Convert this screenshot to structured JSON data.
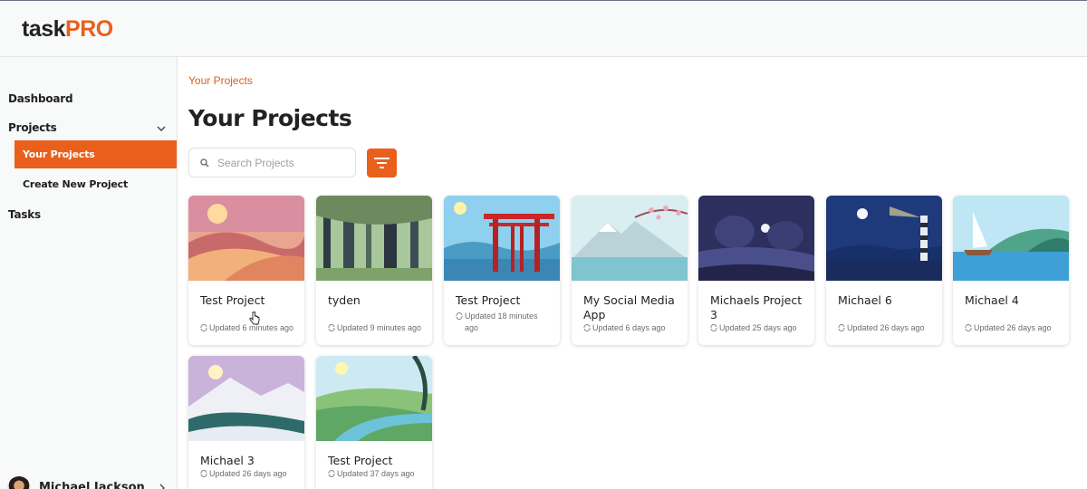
{
  "app": {
    "logo_part1": "task",
    "logo_part2": "PRO"
  },
  "sidebar": {
    "dashboard": "Dashboard",
    "projects": "Projects",
    "your_projects": "Your Projects",
    "create_new_project": "Create New Project",
    "tasks": "Tasks",
    "user_name": "Michael Jackson"
  },
  "main": {
    "breadcrumb": "Your Projects",
    "title": "Your Projects",
    "search_placeholder": "Search Projects"
  },
  "colors": {
    "accent": "#e8601c"
  },
  "projects": [
    {
      "name": "Test Project",
      "updated": "Updated 6 minutes ago",
      "image": "desert-sunset-illustration"
    },
    {
      "name": "tyden",
      "updated": "Updated 9 minutes ago",
      "image": "forest-illustration"
    },
    {
      "name": "Test Project",
      "updated": "Updated 18 minutes ago",
      "image": "torii-gate-illustration"
    },
    {
      "name": "My Social Media App",
      "updated": "Updated 6 days ago",
      "image": "mountain-blossom-illustration"
    },
    {
      "name": "Michaels Project 3",
      "updated": "Updated 25 days ago",
      "image": "night-moon-illustration"
    },
    {
      "name": "Michael 6",
      "updated": "Updated 26 days ago",
      "image": "lighthouse-night-illustration"
    },
    {
      "name": "Michael 4",
      "updated": "Updated 26 days ago",
      "image": "sailboat-lake-illustration"
    },
    {
      "name": "Michael 3",
      "updated": "Updated 26 days ago",
      "image": "snowy-mountain-illustration"
    },
    {
      "name": "Test Project",
      "updated": "Updated 37 days ago",
      "image": "river-valley-illustration"
    }
  ]
}
